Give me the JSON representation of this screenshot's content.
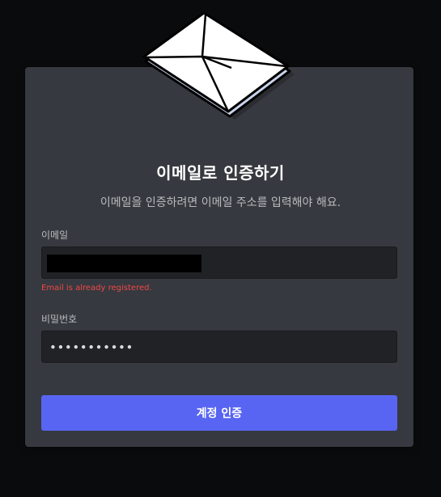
{
  "dialog": {
    "title": "이메일로 인증하기",
    "subtitle": "이메일을 인증하려면 이메일 주소를 입력해야 해요."
  },
  "email_field": {
    "label": "이메일",
    "value": "",
    "error": "Email is already registered."
  },
  "password_field": {
    "label": "비밀번호",
    "value": "•••••••••••"
  },
  "submit_button": {
    "label": "계정 인증"
  },
  "colors": {
    "background": "#0a0b0d",
    "panel": "#36393f",
    "input": "#202225",
    "accent": "#5865f2",
    "error": "#f04747"
  }
}
